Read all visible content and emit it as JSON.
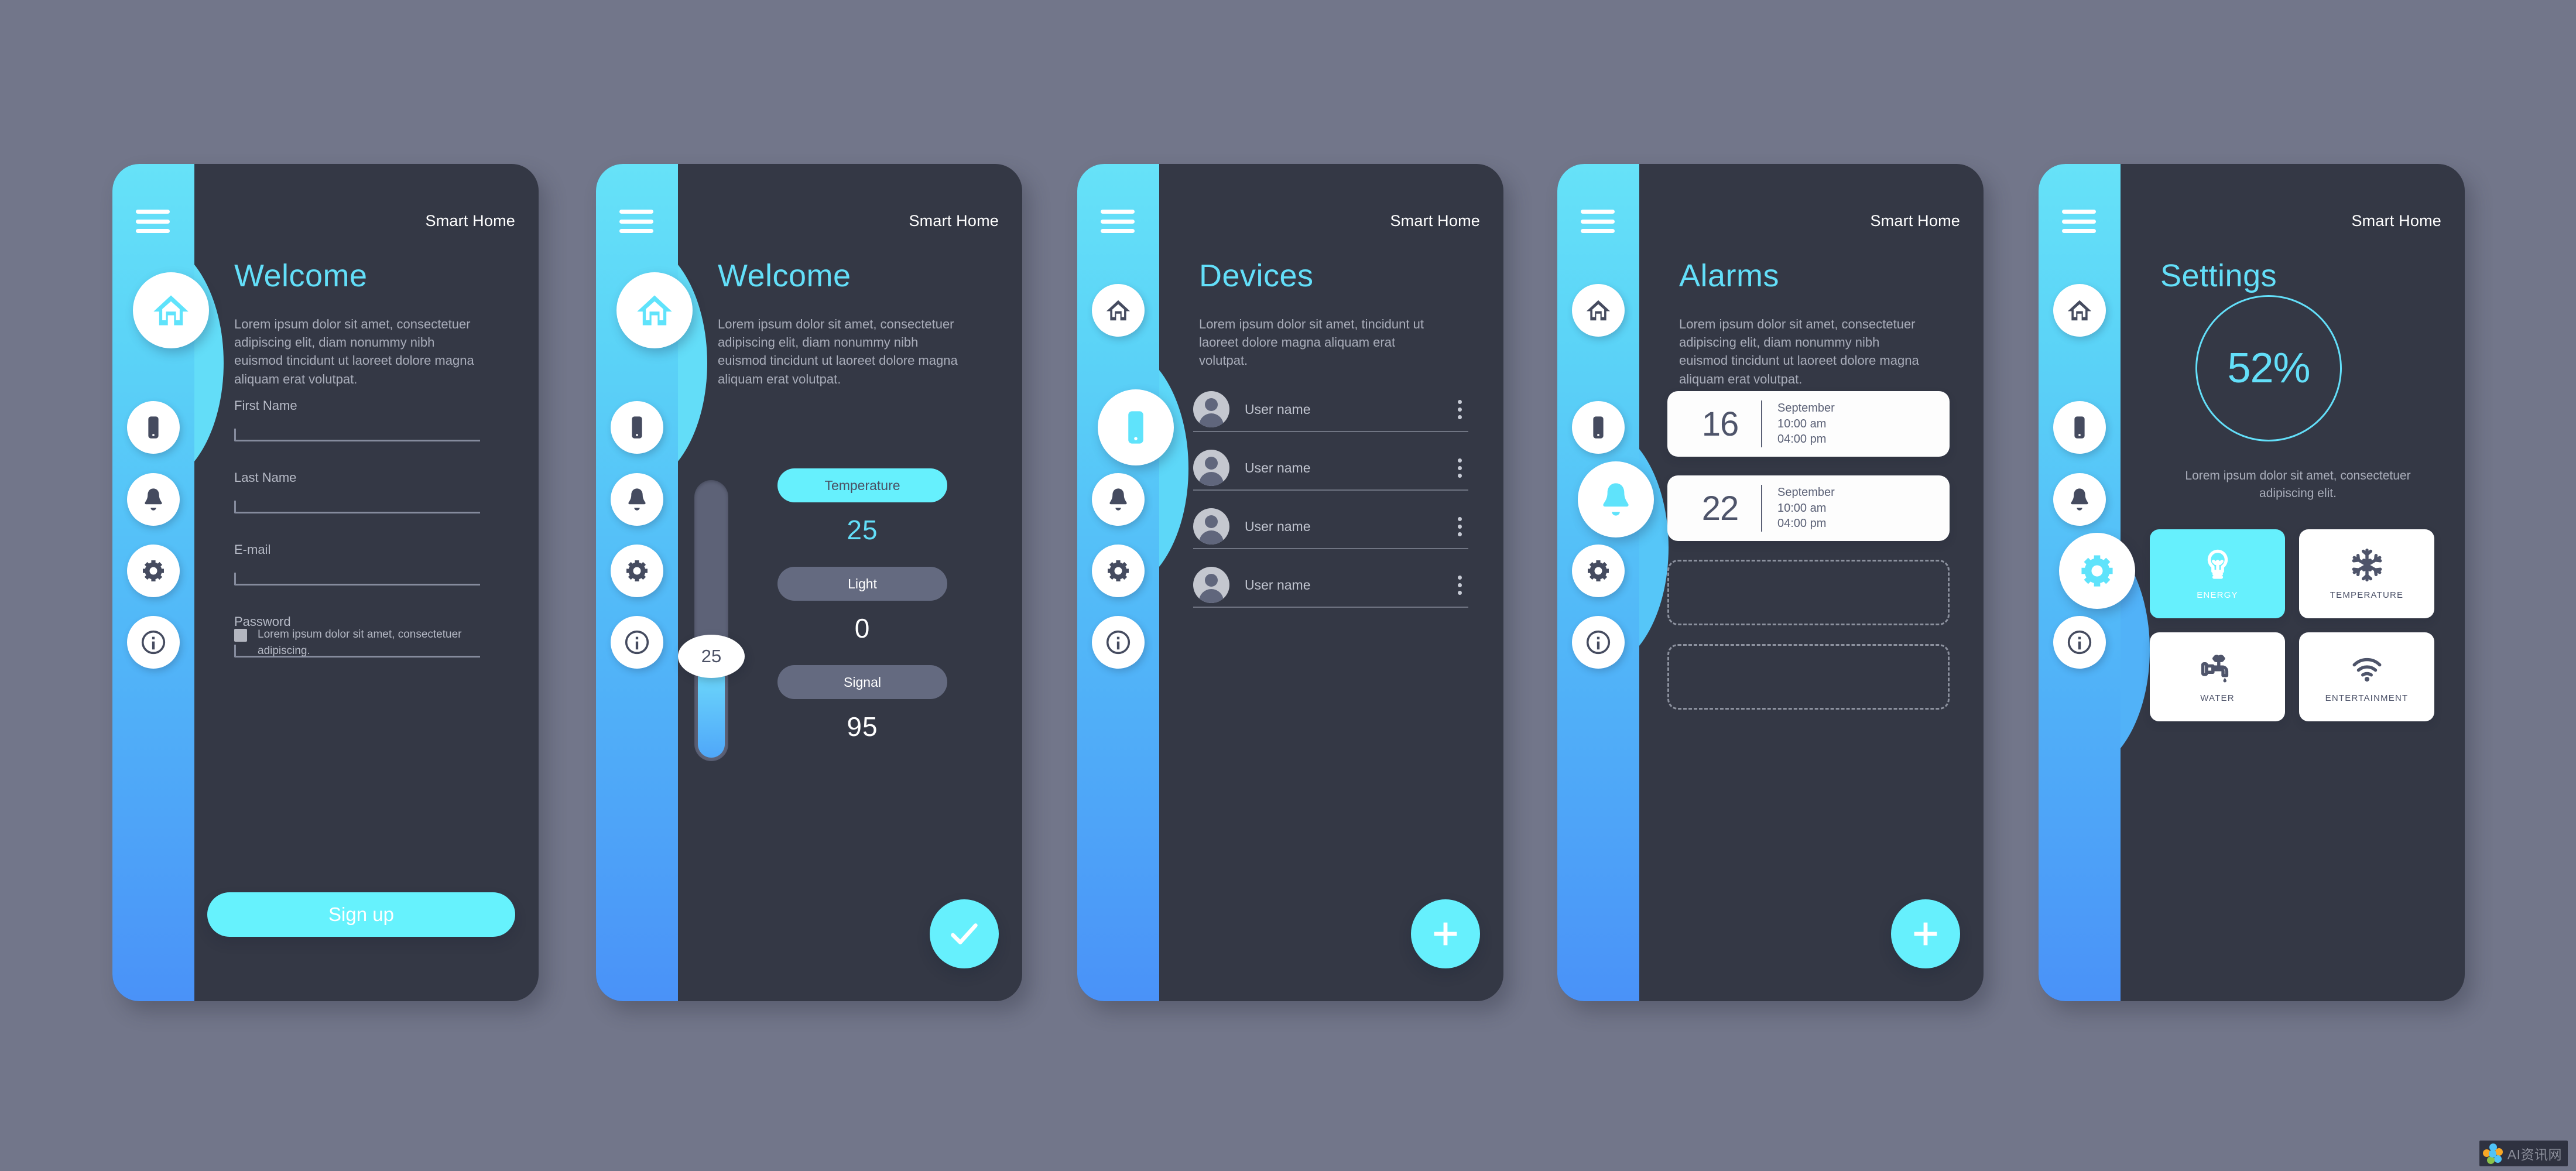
{
  "meta": {
    "background_color": "#72768a",
    "card_color": "#343845",
    "accent_cyan": "#66f0fd",
    "accent_title": "#63dff9",
    "rail_gradient_top": "#66e2f8",
    "rail_gradient_bottom": "#4a92f8",
    "muted_text": "#a9adba"
  },
  "app_title": "Smart Home",
  "rail_icons": [
    {
      "name": "home-icon",
      "label": "Home"
    },
    {
      "name": "phone-icon",
      "label": "Devices"
    },
    {
      "name": "bell-icon",
      "label": "Alarms"
    },
    {
      "name": "gear-icon",
      "label": "Settings"
    },
    {
      "name": "info-icon",
      "label": "Info"
    }
  ],
  "screens": [
    {
      "id": "signup",
      "title": "Welcome",
      "description": "Lorem ipsum dolor sit amet, consectetuer adipiscing elit, diam nonummy nibh euismod tincidunt ut laoreet dolore magna aliquam erat volutpat.",
      "active_rail_index": 0,
      "form": {
        "fields": [
          {
            "label": "First Name",
            "value": "",
            "placeholder": ""
          },
          {
            "label": "Last Name",
            "value": "",
            "placeholder": ""
          },
          {
            "label": "E-mail",
            "value": "",
            "placeholder": ""
          },
          {
            "label": "Password",
            "value": "",
            "placeholder": ""
          }
        ],
        "consent_text": "Lorem ipsum dolor sit amet, consectetuer adipiscing.",
        "consent_checked": false,
        "submit_label": "Sign up"
      }
    },
    {
      "id": "controls",
      "title": "Welcome",
      "description": "Lorem ipsum dolor sit amet, consectetuer adipiscing elit, diam nonummy nibh euismod tincidunt ut laoreet dolore magna aliquam erat volutpat.",
      "active_rail_index": 0,
      "slider": {
        "value": "25",
        "min": 0,
        "max": 100,
        "fill_percent": 33
      },
      "controls": [
        {
          "label": "Temperature",
          "value": "25",
          "state": "on"
        },
        {
          "label": "Light",
          "value": "0",
          "state": "off"
        },
        {
          "label": "Signal",
          "value": "95",
          "state": "off"
        }
      ],
      "fab": {
        "icon": "check-icon",
        "label": "Confirm"
      }
    },
    {
      "id": "devices",
      "title": "Devices",
      "description": "Lorem ipsum dolor sit amet, tincidunt ut laoreet dolore magna aliquam erat volutpat.",
      "active_rail_index": 1,
      "rows": [
        {
          "name": "User name"
        },
        {
          "name": "User name"
        },
        {
          "name": "User name"
        },
        {
          "name": "User name"
        }
      ],
      "fab": {
        "icon": "plus-icon",
        "label": "Add device"
      }
    },
    {
      "id": "alarms",
      "title": "Alarms",
      "description": "Lorem ipsum dolor sit amet, consectetuer adipiscing elit, diam nonummy nibh euismod tincidunt ut laoreet dolore magna aliquam erat volutpat.",
      "active_rail_index": 2,
      "alarms": [
        {
          "day": "16",
          "month": "September",
          "start": "10:00 am",
          "end": "04:00 pm"
        },
        {
          "day": "22",
          "month": "September",
          "start": "10:00 am",
          "end": "04:00 pm"
        }
      ],
      "empty_slots": 2,
      "fab": {
        "icon": "plus-icon",
        "label": "Add alarm"
      }
    },
    {
      "id": "settings",
      "title": "Settings",
      "description": "Lorem ipsum dolor sit amet, consectetuer adipiscing elit.",
      "active_rail_index": 3,
      "gauge": {
        "value": "52%",
        "percent": 52
      },
      "tiles": [
        {
          "label": "ENERGY",
          "icon": "lightbulb-icon",
          "state": "on"
        },
        {
          "label": "TEMPERATURE",
          "icon": "snowflake-icon",
          "state": "off"
        },
        {
          "label": "WATER",
          "icon": "faucet-icon",
          "state": "off"
        },
        {
          "label": "ENTERTAINMENT",
          "icon": "wifi-icon",
          "state": "off"
        }
      ]
    }
  ],
  "watermark": {
    "text": "AI资讯网"
  }
}
